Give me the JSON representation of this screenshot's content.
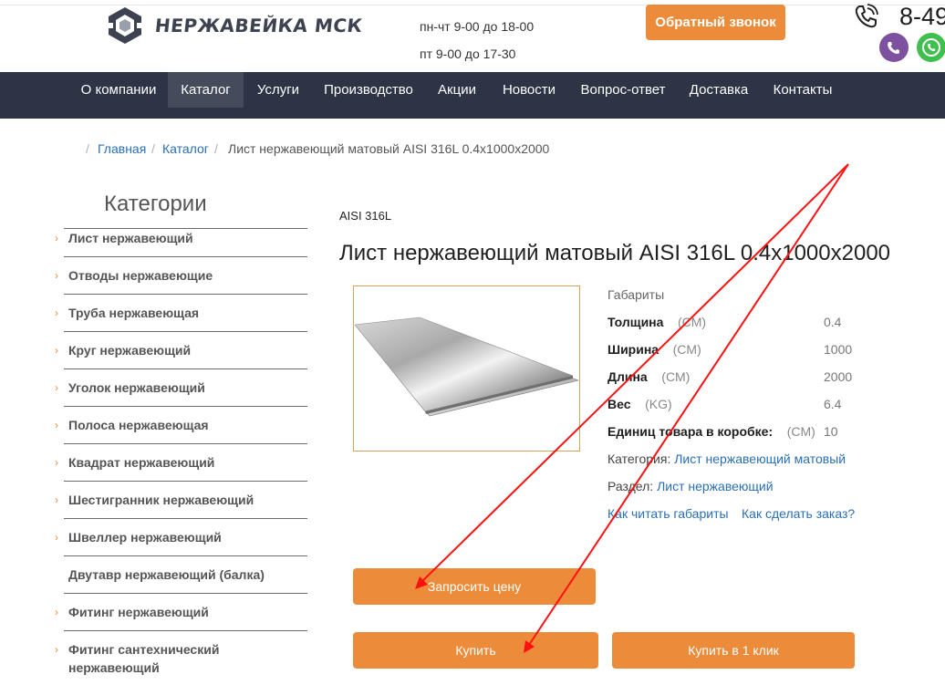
{
  "header": {
    "logo_text": "НЕРЖАВЕЙКА МСК",
    "hours_weekdays": "пн-чт 9-00 до 18-00",
    "hours_friday": "пт 9-00 до 17-30",
    "callback_button": "Обратный звонок",
    "phone_partial": "8-49",
    "accent_color": "#ec8c3b"
  },
  "nav": {
    "items": [
      "О компании",
      "Каталог",
      "Услуги",
      "Производство",
      "Акции",
      "Новости",
      "Вопрос-ответ",
      "Доставка",
      "Контакты"
    ],
    "active": "Каталог",
    "bg_color": "#2c3446"
  },
  "breadcrumb": {
    "home": "Главная",
    "catalog": "Каталог",
    "current": "Лист нержавеющий матовый AISI 316L 0.4x1000x2000"
  },
  "sidebar": {
    "title": "Категории",
    "items": [
      "Лист нержавеющий",
      "Отводы нержавеющие",
      "Труба нержавеющая",
      "Круг нержавеющий",
      "Уголок нержавеющий",
      "Полоса нержавеющая",
      "Квадрат нержавеющий",
      "Шестигранник нержавеющий",
      "Швеллер нержавеющий",
      "Двутавр нержавеющий (балка)",
      "Фитинг нержавеющий",
      "Фитинг сантехнический нержавеющий"
    ]
  },
  "product": {
    "brand": "AISI 316L",
    "title": "Лист нержавеющий матовый AISI 316L 0.4x1000x2000",
    "dims_heading": "Габариты",
    "specs": [
      {
        "label": "Толщина",
        "unit": "(CM)",
        "value": "0.4"
      },
      {
        "label": "Ширина",
        "unit": "(CM)",
        "value": "1000"
      },
      {
        "label": "Длина",
        "unit": "(CM)",
        "value": "2000"
      },
      {
        "label": "Вес",
        "unit": "(KG)",
        "value": "6.4"
      },
      {
        "label": "Единиц товара в коробке:",
        "unit": "(CM)",
        "value": "10"
      }
    ],
    "category_label": "Категория:",
    "category_value": "Лист нержавеющий матовый",
    "section_label": "Раздел:",
    "section_value": "Лист нержавеющий",
    "how_to_read": "Как читать габариты",
    "how_to_order": "Как сделать заказ?",
    "request_price_button": "Запросить цену",
    "buy_button": "Купить",
    "buy_one_click_button": "Купить в 1 клик"
  },
  "annotation": {
    "arrow_color": "#ff0000"
  }
}
